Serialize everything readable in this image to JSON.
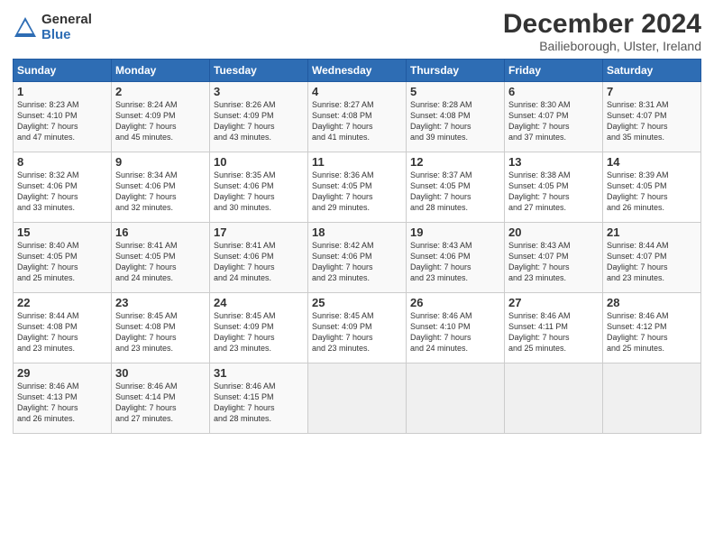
{
  "header": {
    "logo_general": "General",
    "logo_blue": "Blue",
    "month": "December 2024",
    "location": "Bailieborough, Ulster, Ireland"
  },
  "weekdays": [
    "Sunday",
    "Monday",
    "Tuesday",
    "Wednesday",
    "Thursday",
    "Friday",
    "Saturday"
  ],
  "weeks": [
    [
      {
        "day": "1",
        "info": "Sunrise: 8:23 AM\nSunset: 4:10 PM\nDaylight: 7 hours\nand 47 minutes."
      },
      {
        "day": "2",
        "info": "Sunrise: 8:24 AM\nSunset: 4:09 PM\nDaylight: 7 hours\nand 45 minutes."
      },
      {
        "day": "3",
        "info": "Sunrise: 8:26 AM\nSunset: 4:09 PM\nDaylight: 7 hours\nand 43 minutes."
      },
      {
        "day": "4",
        "info": "Sunrise: 8:27 AM\nSunset: 4:08 PM\nDaylight: 7 hours\nand 41 minutes."
      },
      {
        "day": "5",
        "info": "Sunrise: 8:28 AM\nSunset: 4:08 PM\nDaylight: 7 hours\nand 39 minutes."
      },
      {
        "day": "6",
        "info": "Sunrise: 8:30 AM\nSunset: 4:07 PM\nDaylight: 7 hours\nand 37 minutes."
      },
      {
        "day": "7",
        "info": "Sunrise: 8:31 AM\nSunset: 4:07 PM\nDaylight: 7 hours\nand 35 minutes."
      }
    ],
    [
      {
        "day": "8",
        "info": "Sunrise: 8:32 AM\nSunset: 4:06 PM\nDaylight: 7 hours\nand 33 minutes."
      },
      {
        "day": "9",
        "info": "Sunrise: 8:34 AM\nSunset: 4:06 PM\nDaylight: 7 hours\nand 32 minutes."
      },
      {
        "day": "10",
        "info": "Sunrise: 8:35 AM\nSunset: 4:06 PM\nDaylight: 7 hours\nand 30 minutes."
      },
      {
        "day": "11",
        "info": "Sunrise: 8:36 AM\nSunset: 4:05 PM\nDaylight: 7 hours\nand 29 minutes."
      },
      {
        "day": "12",
        "info": "Sunrise: 8:37 AM\nSunset: 4:05 PM\nDaylight: 7 hours\nand 28 minutes."
      },
      {
        "day": "13",
        "info": "Sunrise: 8:38 AM\nSunset: 4:05 PM\nDaylight: 7 hours\nand 27 minutes."
      },
      {
        "day": "14",
        "info": "Sunrise: 8:39 AM\nSunset: 4:05 PM\nDaylight: 7 hours\nand 26 minutes."
      }
    ],
    [
      {
        "day": "15",
        "info": "Sunrise: 8:40 AM\nSunset: 4:05 PM\nDaylight: 7 hours\nand 25 minutes."
      },
      {
        "day": "16",
        "info": "Sunrise: 8:41 AM\nSunset: 4:05 PM\nDaylight: 7 hours\nand 24 minutes."
      },
      {
        "day": "17",
        "info": "Sunrise: 8:41 AM\nSunset: 4:06 PM\nDaylight: 7 hours\nand 24 minutes."
      },
      {
        "day": "18",
        "info": "Sunrise: 8:42 AM\nSunset: 4:06 PM\nDaylight: 7 hours\nand 23 minutes."
      },
      {
        "day": "19",
        "info": "Sunrise: 8:43 AM\nSunset: 4:06 PM\nDaylight: 7 hours\nand 23 minutes."
      },
      {
        "day": "20",
        "info": "Sunrise: 8:43 AM\nSunset: 4:07 PM\nDaylight: 7 hours\nand 23 minutes."
      },
      {
        "day": "21",
        "info": "Sunrise: 8:44 AM\nSunset: 4:07 PM\nDaylight: 7 hours\nand 23 minutes."
      }
    ],
    [
      {
        "day": "22",
        "info": "Sunrise: 8:44 AM\nSunset: 4:08 PM\nDaylight: 7 hours\nand 23 minutes."
      },
      {
        "day": "23",
        "info": "Sunrise: 8:45 AM\nSunset: 4:08 PM\nDaylight: 7 hours\nand 23 minutes."
      },
      {
        "day": "24",
        "info": "Sunrise: 8:45 AM\nSunset: 4:09 PM\nDaylight: 7 hours\nand 23 minutes."
      },
      {
        "day": "25",
        "info": "Sunrise: 8:45 AM\nSunset: 4:09 PM\nDaylight: 7 hours\nand 23 minutes."
      },
      {
        "day": "26",
        "info": "Sunrise: 8:46 AM\nSunset: 4:10 PM\nDaylight: 7 hours\nand 24 minutes."
      },
      {
        "day": "27",
        "info": "Sunrise: 8:46 AM\nSunset: 4:11 PM\nDaylight: 7 hours\nand 25 minutes."
      },
      {
        "day": "28",
        "info": "Sunrise: 8:46 AM\nSunset: 4:12 PM\nDaylight: 7 hours\nand 25 minutes."
      }
    ],
    [
      {
        "day": "29",
        "info": "Sunrise: 8:46 AM\nSunset: 4:13 PM\nDaylight: 7 hours\nand 26 minutes."
      },
      {
        "day": "30",
        "info": "Sunrise: 8:46 AM\nSunset: 4:14 PM\nDaylight: 7 hours\nand 27 minutes."
      },
      {
        "day": "31",
        "info": "Sunrise: 8:46 AM\nSunset: 4:15 PM\nDaylight: 7 hours\nand 28 minutes."
      },
      {
        "day": "",
        "info": ""
      },
      {
        "day": "",
        "info": ""
      },
      {
        "day": "",
        "info": ""
      },
      {
        "day": "",
        "info": ""
      }
    ]
  ]
}
